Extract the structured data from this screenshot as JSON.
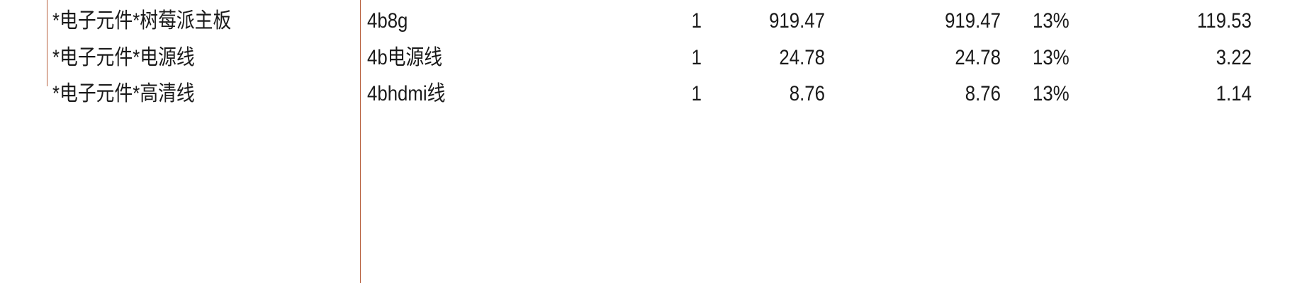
{
  "invoice_items": [
    {
      "name": "*电子元件*树莓派主板",
      "model": "4b8g",
      "quantity": "1",
      "unit_price": "919.47",
      "amount": "919.47",
      "tax_rate": "13%",
      "tax_amount": "119.53"
    },
    {
      "name": "*电子元件*电源线",
      "model": "4b电源线",
      "quantity": "1",
      "unit_price": "24.78",
      "amount": "24.78",
      "tax_rate": "13%",
      "tax_amount": "3.22"
    },
    {
      "name": "*电子元件*高清线",
      "model": "4bhdmi线",
      "quantity": "1",
      "unit_price": "8.76",
      "amount": "8.76",
      "tax_rate": "13%",
      "tax_amount": "1.14"
    }
  ]
}
